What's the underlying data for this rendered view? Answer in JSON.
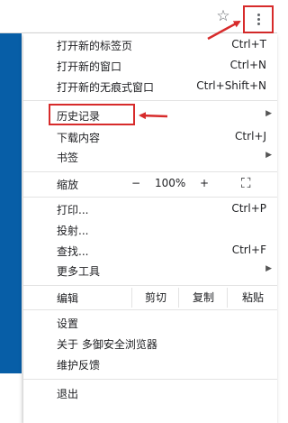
{
  "toolbar": {
    "star_glyph": "☆"
  },
  "menu": {
    "new_tab": {
      "label": "打开新的标签页",
      "shortcut": "Ctrl+T"
    },
    "new_window": {
      "label": "打开新的窗口",
      "shortcut": "Ctrl+N"
    },
    "incognito": {
      "label": "打开新的无痕式窗口",
      "shortcut": "Ctrl+Shift+N"
    },
    "history": {
      "label": "历史记录"
    },
    "downloads": {
      "label": "下载内容",
      "shortcut": "Ctrl+J"
    },
    "bookmarks": {
      "label": "书签"
    },
    "zoom": {
      "label": "缩放",
      "minus": "−",
      "value": "100%",
      "plus": "+",
      "fullscreen": "⛶"
    },
    "print": {
      "label": "打印...",
      "shortcut": "Ctrl+P"
    },
    "cast": {
      "label": "投射..."
    },
    "find": {
      "label": "查找...",
      "shortcut": "Ctrl+F"
    },
    "more_tools": {
      "label": "更多工具"
    },
    "edit": {
      "label": "编辑",
      "cut": "剪切",
      "copy": "复制",
      "paste": "粘贴"
    },
    "settings": {
      "label": "设置"
    },
    "about": {
      "label": "关于 多御安全浏览器"
    },
    "feedback": {
      "label": "维护反馈"
    },
    "exit": {
      "label": "退出"
    },
    "submenu_arrow": "▶"
  },
  "colors": {
    "annotation_red": "#d72b2b",
    "page_blue": "#075ea7"
  }
}
